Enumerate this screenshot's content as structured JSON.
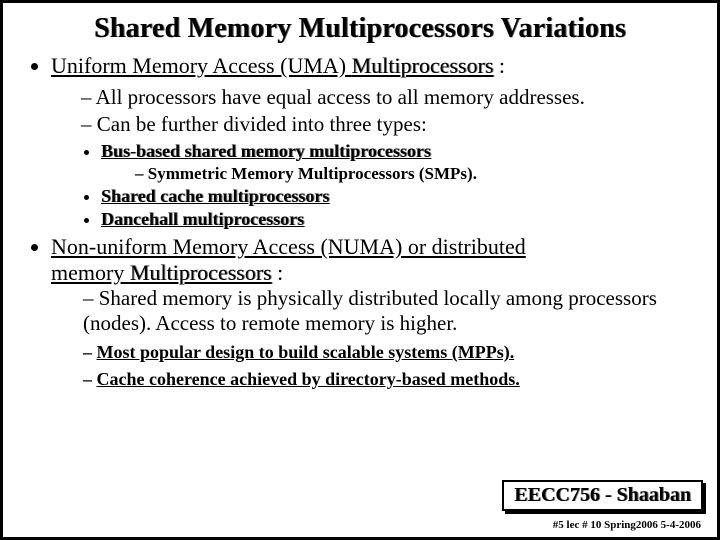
{
  "title": "Shared Memory Multiprocessors Variations",
  "uma": {
    "head_prefix": "Uniform Memory Access (UMA) ",
    "head_word": "Multiprocessors",
    "head_suffix": " :",
    "p1": "All processors have equal access to all memory addresses.",
    "p2": "Can be further divided into three types:",
    "t1": "Bus-based shared memory multiprocessors",
    "t1_sub": "Symmetric Memory Multiprocessors (SMPs).",
    "t2": "Shared cache multiprocessors",
    "t3": "Dancehall multiprocessors"
  },
  "numa": {
    "line1": "Non-uniform Memory Access (NUMA) or distributed",
    "line2_prefix": "memory ",
    "line2_word": "Multiprocessors",
    "line2_suffix": " :",
    "p1": "Shared memory is physically distributed locally among processors (nodes).  Access to remote memory is higher.",
    "p2": "Most popular design to build scalable systems (MPPs).",
    "p3": "Cache coherence achieved by directory-based methods."
  },
  "footer": {
    "box": "EECC756 - Shaaban",
    "small": "#5  lec # 10    Spring2006  5-4-2006"
  }
}
